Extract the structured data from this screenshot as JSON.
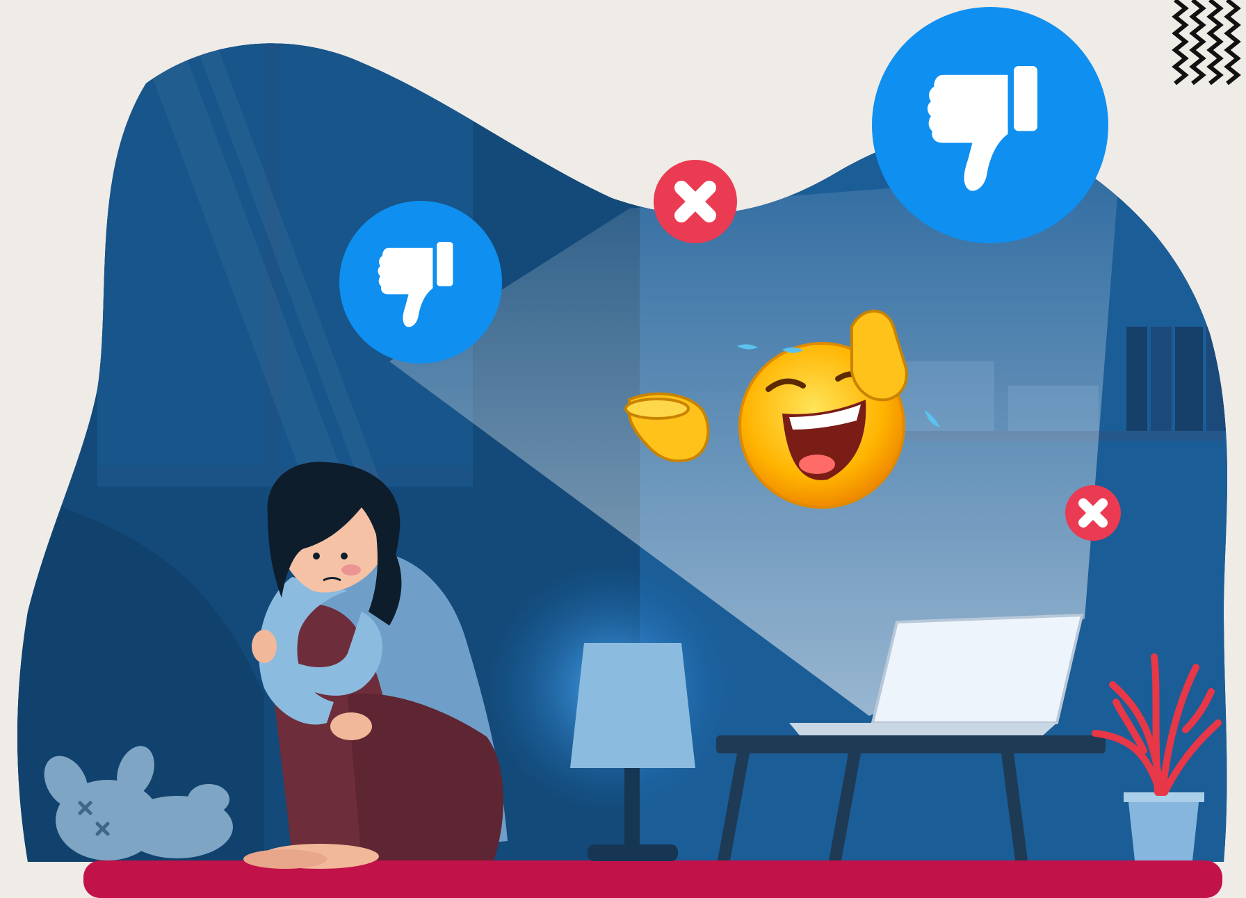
{
  "scene": {
    "background_color": "#efebe6",
    "blob_color": "#154f80",
    "floor_color": "#c2124a",
    "accent_blue": "#0f8ff0",
    "reject_red": "#ea3b52"
  },
  "icons": [
    {
      "name": "thumbs-down-icon-left",
      "semantic": "thumbs-down-icon"
    },
    {
      "name": "thumbs-down-icon-right",
      "semantic": "thumbs-down-icon"
    },
    {
      "name": "close-icon-top",
      "semantic": "close-icon"
    },
    {
      "name": "close-icon-right",
      "semantic": "close-icon"
    },
    {
      "name": "laughing-emoji-icon",
      "semantic": "crying-laughing-pointing-emoji"
    }
  ],
  "objects": [
    "sad-girl-hugging-knees",
    "plush-toy",
    "table-lamp",
    "laptop",
    "low-table",
    "potted-plant",
    "bookshelf",
    "window"
  ]
}
